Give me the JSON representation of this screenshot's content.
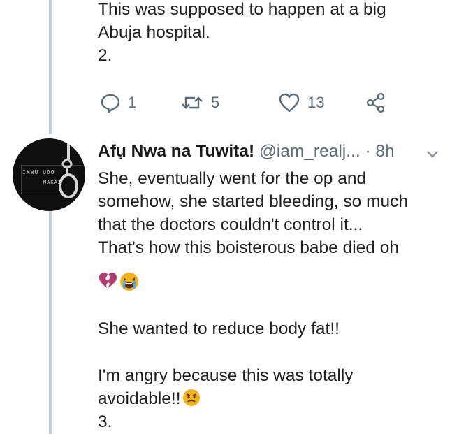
{
  "tweet1": {
    "text": "This was supposed to happen at a big\nAbuja hospital.\n2.",
    "actions": {
      "reply_count": "1",
      "retweet_count": "5",
      "like_count": "13",
      "icons": [
        "reply-icon",
        "retweet-icon",
        "heart-icon",
        "share-icon"
      ]
    }
  },
  "tweet2": {
    "avatar": {
      "book_title": "IKWU UDO",
      "book_subtitle": "MAKAZ"
    },
    "display_name": "Afụ Nwa na Tuwita!",
    "handle": "@iam_realj...",
    "time": "· 8h",
    "paragraph1": "She, eventually went for the op and\nsomehow, she started bleeding, so much\nthat the doctors couldn't control it...\nThat's how this boisterous babe died oh",
    "emojis1": [
      "broken-heart-emoji",
      "crying-face-emoji"
    ],
    "paragraph2": "She wanted to reduce body fat!!",
    "paragraph3": "I'm angry because this was totally\navoidable!!",
    "emoji3": "angry-face-emoji",
    "thread_number": "3."
  },
  "colors": {
    "text": "#1f1f1f",
    "muted": "#5b6b78",
    "thread_line": "#c6ced6",
    "broken_heart": "#b03a6f",
    "emoji_yellow": "#f6b21a"
  }
}
